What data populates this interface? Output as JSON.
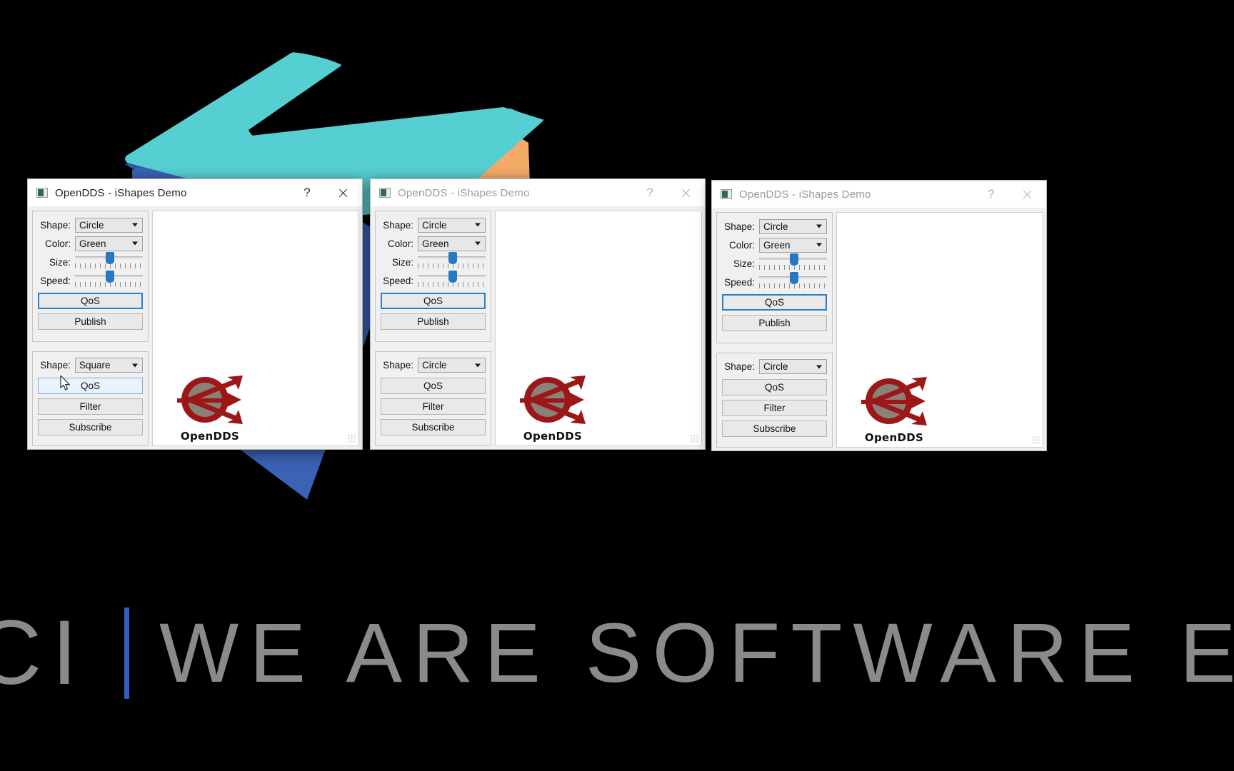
{
  "background": {
    "canvas_color": "#000000",
    "shape_colors": {
      "teal": "#55cfd2",
      "blue": "#3a62b5",
      "orange": "#f5ab68",
      "dark_blue": "#2f55a8"
    }
  },
  "banner": {
    "ci_text": "CI",
    "divider_color": "#2f5fc0",
    "tagline": "WE ARE SOFTWARE ENGINEER",
    "text_color": "#8a8a8a"
  },
  "windows": [
    {
      "id": "window-1",
      "active": true,
      "title": "OpenDDS - iShapes Demo",
      "help_label": "?",
      "close_label": "✕",
      "publisher": {
        "shape_label": "Shape:",
        "shape_value": "Circle",
        "color_label": "Color:",
        "color_value": "Green",
        "size_label": "Size:",
        "speed_label": "Speed:",
        "qos_label": "QoS",
        "publish_label": "Publish"
      },
      "subscriber": {
        "shape_label": "Shape:",
        "shape_value": "Square",
        "qos_label": "QoS",
        "filter_label": "Filter",
        "subscribe_label": "Subscribe"
      },
      "logo_text": "OpenDDS"
    },
    {
      "id": "window-2",
      "active": false,
      "title": "OpenDDS - iShapes Demo",
      "help_label": "?",
      "close_label": "✕",
      "publisher": {
        "shape_label": "Shape:",
        "shape_value": "Circle",
        "color_label": "Color:",
        "color_value": "Green",
        "size_label": "Size:",
        "speed_label": "Speed:",
        "qos_label": "QoS",
        "publish_label": "Publish"
      },
      "subscriber": {
        "shape_label": "Shape:",
        "shape_value": "Circle",
        "qos_label": "QoS",
        "filter_label": "Filter",
        "subscribe_label": "Subscribe"
      },
      "logo_text": "OpenDDS"
    },
    {
      "id": "window-3",
      "active": false,
      "title": "OpenDDS - iShapes Demo",
      "help_label": "?",
      "close_label": "✕",
      "publisher": {
        "shape_label": "Shape:",
        "shape_value": "Circle",
        "color_label": "Color:",
        "color_value": "Green",
        "size_label": "Size:",
        "speed_label": "Speed:",
        "qos_label": "QoS",
        "publish_label": "Publish"
      },
      "subscriber": {
        "shape_label": "Shape:",
        "shape_value": "Circle",
        "qos_label": "QoS",
        "filter_label": "Filter",
        "subscribe_label": "Subscribe"
      },
      "logo_text": "OpenDDS"
    }
  ]
}
